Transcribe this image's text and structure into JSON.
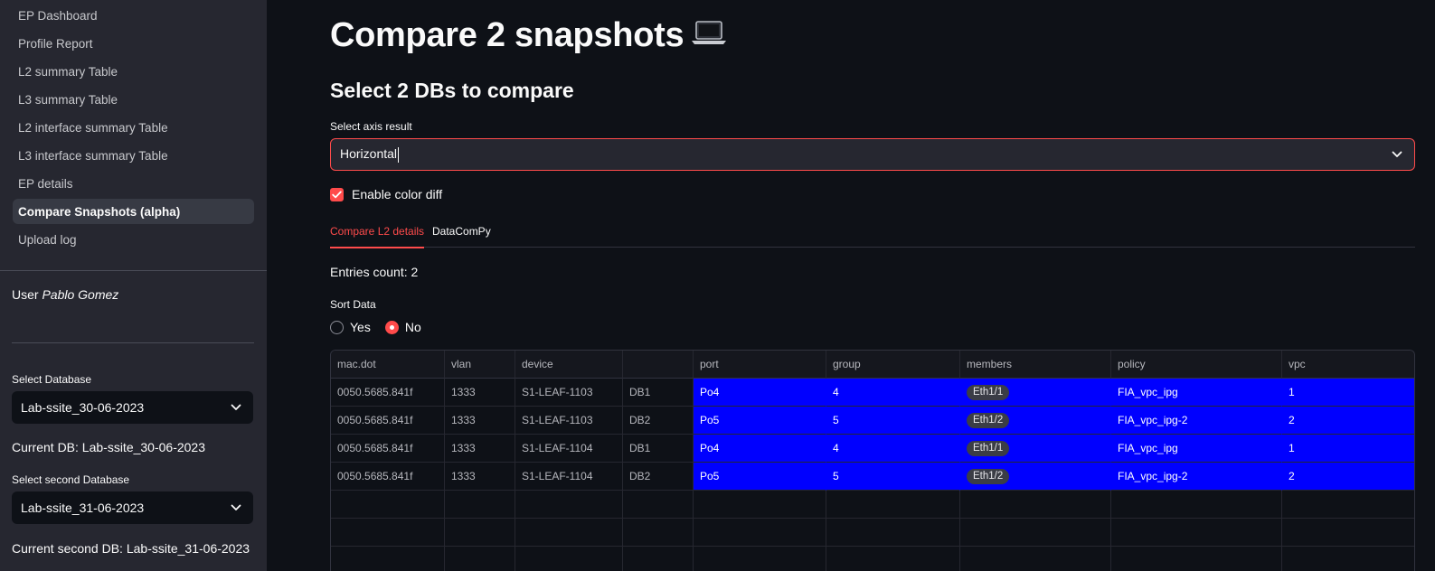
{
  "sidebar": {
    "nav": [
      {
        "label": "EP Dashboard"
      },
      {
        "label": "Profile Report"
      },
      {
        "label": "L2 summary Table"
      },
      {
        "label": "L3 summary Table"
      },
      {
        "label": "L2 interface summary Table"
      },
      {
        "label": "L3 interface summary Table"
      },
      {
        "label": "EP details"
      },
      {
        "label": "Compare Snapshots (alpha)"
      },
      {
        "label": "Upload log"
      }
    ],
    "active_index": 7,
    "user_prefix": "User",
    "user_name": "Pablo Gomez",
    "select_db_label": "Select Database",
    "select_db_value": "Lab-ssite_30-06-2023",
    "current_db": "Current DB: Lab-ssite_30-06-2023",
    "select_second_db_label": "Select second Database",
    "select_second_db_value": "Lab-ssite_31-06-2023",
    "current_second_db": "Current second DB: Lab-ssite_31-06-2023"
  },
  "main": {
    "title": "Compare 2 snapshots",
    "title_icon": "laptop-icon",
    "subtitle": "Select 2 DBs to compare",
    "axis_label": "Select axis result",
    "axis_value": "Horizontal",
    "color_diff_label": "Enable color diff",
    "color_diff_checked": true,
    "tabs": [
      {
        "label": "Compare L2 details"
      },
      {
        "label": "DataComPy"
      }
    ],
    "active_tab": 0,
    "entries_count": "Entries count: 2",
    "sort_label": "Sort Data",
    "sort_options": [
      {
        "label": "Yes"
      },
      {
        "label": "No"
      }
    ],
    "sort_selected": "No"
  },
  "table": {
    "columns": [
      "mac.dot",
      "vlan",
      "device",
      "",
      "port",
      "group",
      "members",
      "policy",
      "vpc"
    ],
    "rows": [
      [
        "0050.5685.841f",
        "1333",
        "S1-LEAF-1103",
        "DB1",
        "Po4",
        "4",
        "Eth1/1",
        "FIA_vpc_ipg",
        "1"
      ],
      [
        "0050.5685.841f",
        "1333",
        "S1-LEAF-1103",
        "DB2",
        "Po5",
        "5",
        "Eth1/2",
        "FIA_vpc_ipg-2",
        "2"
      ],
      [
        "0050.5685.841f",
        "1333",
        "S1-LEAF-1104",
        "DB1",
        "Po4",
        "4",
        "Eth1/1",
        "FIA_vpc_ipg",
        "1"
      ],
      [
        "0050.5685.841f",
        "1333",
        "S1-LEAF-1104",
        "DB2",
        "Po5",
        "5",
        "Eth1/2",
        "FIA_vpc_ipg-2",
        "2"
      ]
    ],
    "highlight_color": "#0000ff"
  },
  "colors": {
    "accent": "#ff4b4b",
    "background": "#0e1117",
    "sidebar": "#262730"
  }
}
